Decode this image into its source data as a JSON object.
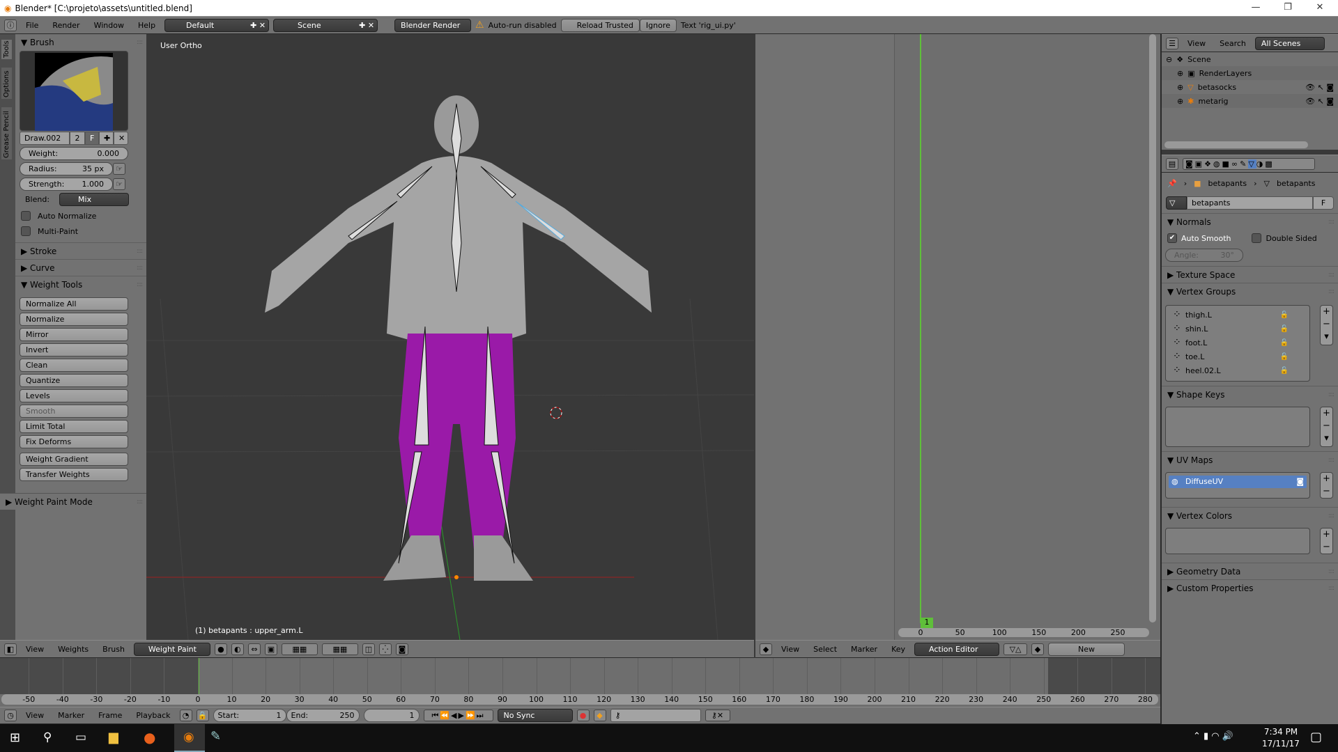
{
  "window": {
    "title": "Blender* [C:\\projeto\\assets\\untitled.blend]",
    "minimize": "—",
    "restore": "❐",
    "close": "✕"
  },
  "info_header": {
    "menus": [
      "File",
      "Render",
      "Window",
      "Help"
    ],
    "layout": "Default",
    "scene": "Scene",
    "engine": "Blender Render",
    "warning": "Auto-run disabled",
    "reload": "Reload Trusted",
    "ignore": "Ignore",
    "text_info": "Text 'rig_ui.py'"
  },
  "toolshelf": {
    "tabs": [
      "Tools",
      "Options",
      "Grease Pencil"
    ],
    "brush_section": "Brush",
    "brush_name": "Draw.002",
    "brush_users": "2",
    "fake_user": "F",
    "weight": {
      "label": "Weight:",
      "value": "0.000"
    },
    "radius": {
      "label": "Radius:",
      "value": "35 px"
    },
    "strength": {
      "label": "Strength:",
      "value": "1.000"
    },
    "blend": {
      "label": "Blend:",
      "value": "Mix"
    },
    "auto_normalize": "Auto Normalize",
    "multi_paint": "Multi-Paint",
    "stroke": "Stroke",
    "curve": "Curve",
    "weight_tools": "Weight Tools",
    "tools": [
      "Normalize All",
      "Normalize",
      "Mirror",
      "Invert",
      "Clean",
      "Quantize",
      "Levels",
      "Smooth",
      "Limit Total",
      "Fix Deforms",
      "Weight Gradient",
      "Transfer Weights"
    ],
    "mode_panel": "Weight Paint Mode"
  },
  "viewport": {
    "view_name": "User Ortho",
    "object_info": "(1) betapants : upper_arm.L",
    "header_menus": [
      "View",
      "Weights",
      "Brush"
    ],
    "mode": "Weight Paint"
  },
  "action_editor": {
    "current_frame": "1",
    "ruler": [
      "0",
      "50",
      "100",
      "150",
      "200",
      "250"
    ],
    "header_menus": [
      "View",
      "Select",
      "Marker",
      "Key"
    ],
    "mode": "Action Editor",
    "new": "New"
  },
  "outliner": {
    "menus": [
      "View",
      "Search"
    ],
    "filter": "All Scenes",
    "items": [
      {
        "name": "Scene"
      },
      {
        "name": "RenderLayers"
      },
      {
        "name": "betasocks"
      },
      {
        "name": "metarig"
      }
    ]
  },
  "properties": {
    "breadcrumb": [
      "betapants",
      "betapants"
    ],
    "mesh_name": "betapants",
    "fake_user": "F",
    "normals": "Normals",
    "auto_smooth": "Auto Smooth",
    "double_sided": "Double Sided",
    "angle": {
      "label": "Angle:",
      "value": "30°"
    },
    "texture_space": "Texture Space",
    "vertex_groups": "Vertex Groups",
    "groups": [
      "thigh.L",
      "shin.L",
      "foot.L",
      "toe.L",
      "heel.02.L"
    ],
    "shape_keys": "Shape Keys",
    "uv_maps": "UV Maps",
    "uv_list": [
      "DiffuseUV"
    ],
    "vertex_colors": "Vertex Colors",
    "geometry_data": "Geometry Data",
    "custom_properties": "Custom Properties"
  },
  "timeline": {
    "ruler": [
      "-50",
      "-40",
      "-30",
      "-20",
      "-10",
      "0",
      "10",
      "20",
      "30",
      "40",
      "50",
      "60",
      "70",
      "80",
      "90",
      "100",
      "110",
      "120",
      "130",
      "140",
      "150",
      "160",
      "170",
      "180",
      "190",
      "200",
      "210",
      "220",
      "230",
      "240",
      "250",
      "260",
      "270",
      "280"
    ],
    "menus": [
      "View",
      "Marker",
      "Frame",
      "Playback"
    ],
    "start": {
      "label": "Start:",
      "value": "1"
    },
    "end": {
      "label": "End:",
      "value": "250"
    },
    "current": "1",
    "sync": "No Sync"
  },
  "taskbar": {
    "time": "7:34 PM",
    "date": "17/11/17"
  },
  "colors": {
    "accent": "#5680c2",
    "frame_green": "#5fbf3a",
    "weight_purple": "#9a1aa8",
    "warning": "#f0a020"
  }
}
